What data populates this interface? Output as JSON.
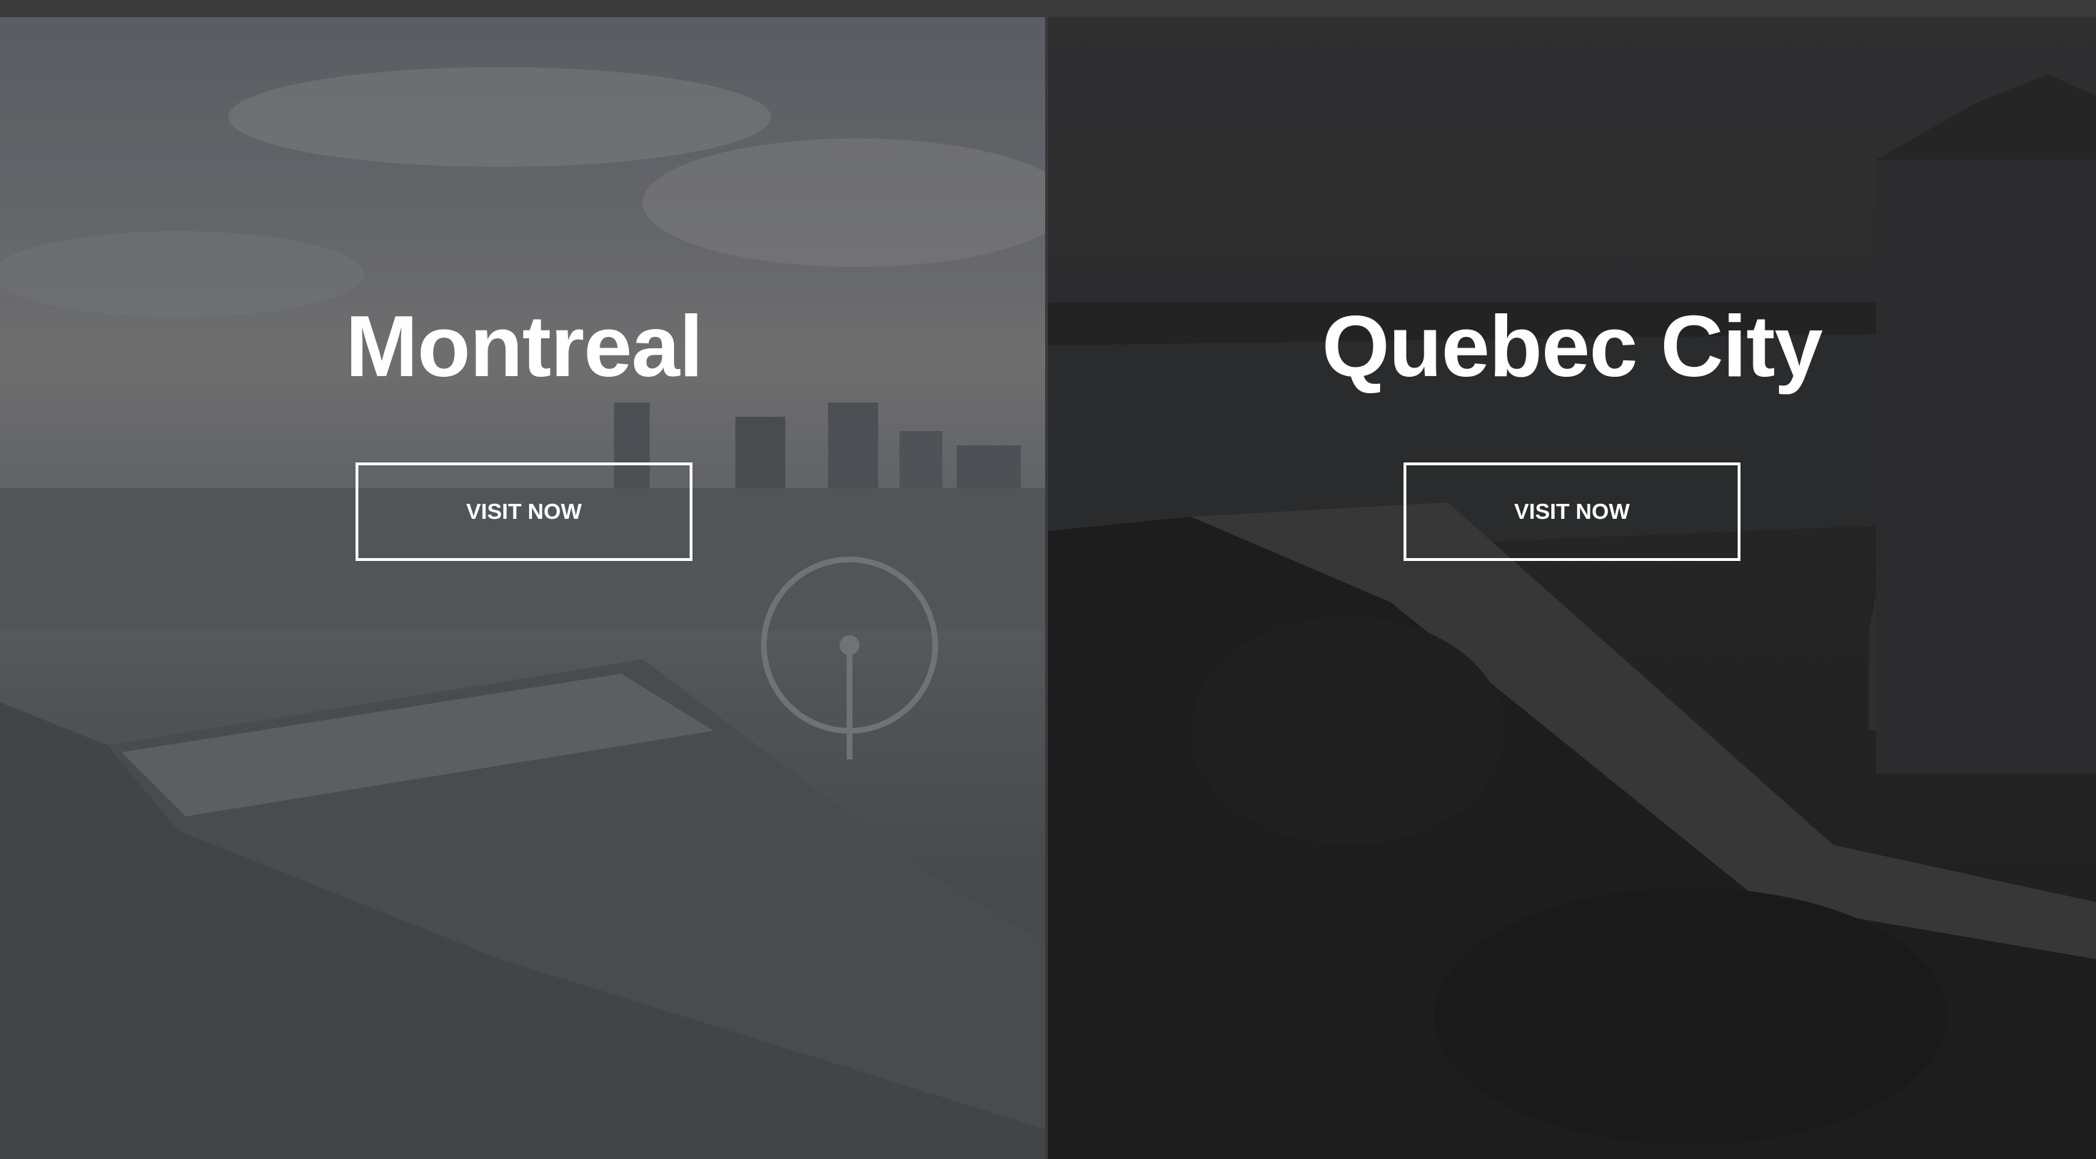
{
  "panels": [
    {
      "city": "Montreal",
      "button_label": "VISIT NOW"
    },
    {
      "city": "Quebec City",
      "button_label": "VISIT NOW"
    }
  ],
  "colors": {
    "title_text": "#ffffff",
    "button_border": "#ffffff",
    "left_overlay": "#5c5f62",
    "right_overlay": "#2a2a2b"
  }
}
